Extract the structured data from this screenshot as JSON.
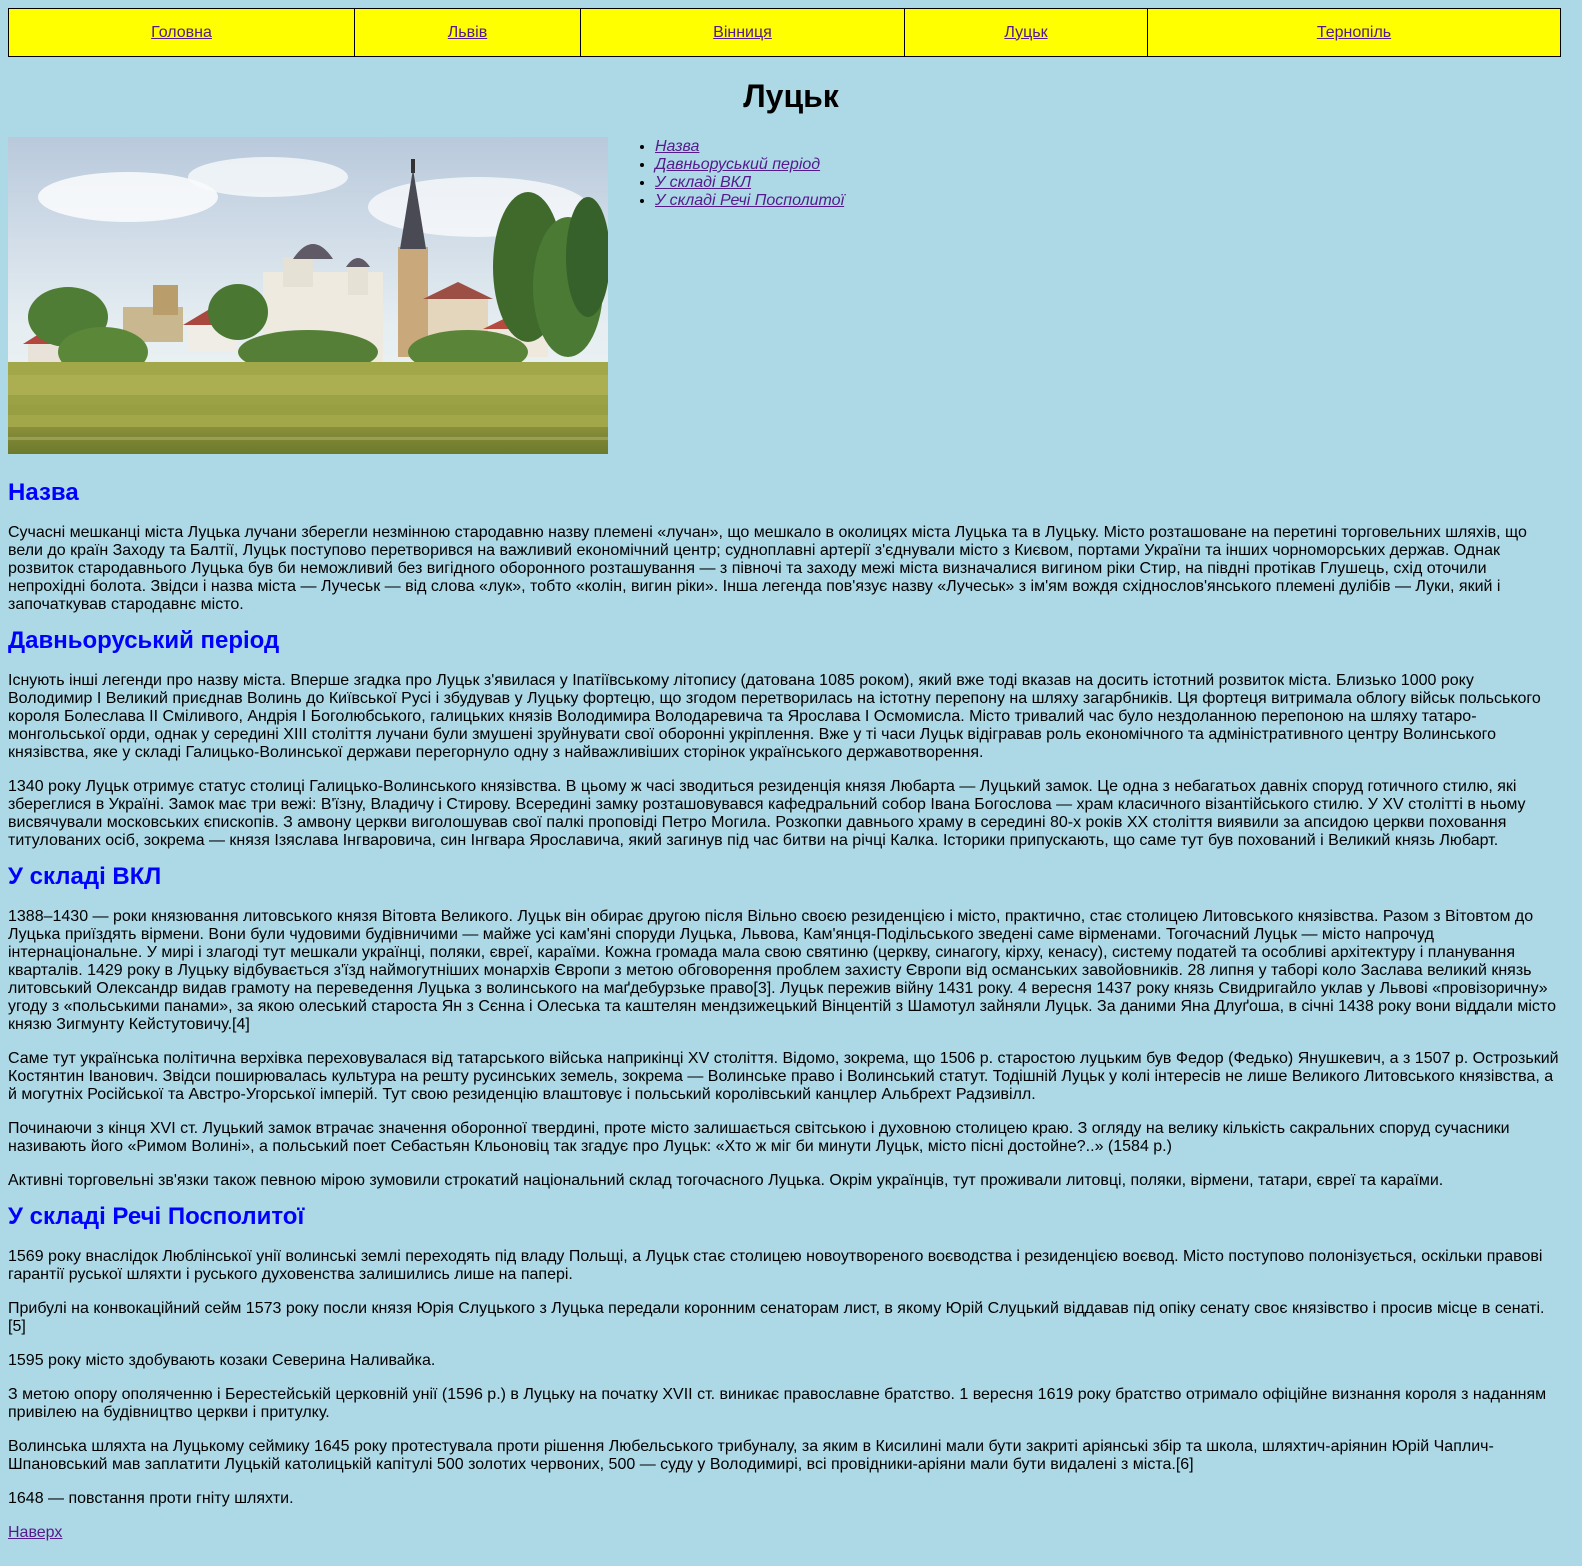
{
  "nav": [
    "Головна",
    "Львів",
    "Вінниця",
    "Луцьк",
    "Тернопіль"
  ],
  "page_title": "Луцьк",
  "toc": [
    "Назва",
    "Давньоруський період",
    "У складі ВКЛ",
    "У складі Речі Посполитої"
  ],
  "colors": {
    "background": "#add8e6",
    "nav_background": "#ffff00",
    "heading": "#0000ff",
    "link": "#551a8b"
  },
  "sections": [
    {
      "heading": "Назва",
      "paragraphs": [
        "Сучасні мешканці міста Луцька лучани зберегли незмінною стародавню назву племені «лучан», що мешкало в околицях міста Луцька та в Луцьку. Місто розташоване на перетині торговельних шляхів, що вели до країн Заходу та Балтії, Луцьк поступово перетворився на важливий економічний центр; судноплавні артерії з'єднували місто з Києвом, портами України та інших чорноморських держав. Однак розвиток стародавнього Луцька був би неможливий без вигідного оборонного розташування — з півночі та заходу межі міста визначалися вигином ріки Стир, на півдні протікав Глушець, схід оточили непрохідні болота. Звідси і назва міста — Лучеськ — від слова «лук», тобто «колін, вигин ріки». Інша легенда пов'язує назву «Лучеськ» з ім'ям вождя східнослов'янського племені дулібів — Луки, який і започаткував стародавнє місто."
      ]
    },
    {
      "heading": "Давньоруський період",
      "paragraphs": [
        "Існують інші легенди про назву міста. Вперше згадка про Луцьк з'явилася у Іпатіївському літопису (датована 1085 роком), який вже тоді вказав на досить істотний розвиток міста. Близько 1000 року Володимир I Великий приєднав Волинь до Київської Русі і збудував у Луцьку фортецю, що згодом перетворилась на істотну перепону на шляху загарбників. Ця фортеця витримала облогу військ польського короля Болеслава II Сміливого, Андрія I Боголюбського, галицьких князів Володимира Володаревича та Ярослава I Осмомисла. Місто тривалий час було нездоланною перепоною на шляху татаро-монгольської орди, однак у середині XIII століття лучани були змушені зруйнувати свої оборонні укріплення. Вже у ті часи Луцьк відігравав роль економічного та адміністративного центру Волинського князівства, яке у складі Галицько-Волинської держави перегорнуло одну з найважливіших сторінок українського державотворення.",
        "1340 року Луцьк отримує статус столиці Галицько-Волинського князівства. В цьому ж часі зводиться резиденція князя Любарта — Луцький замок. Це одна з небагатьох давніх споруд готичного стилю, які збереглися в Україні. Замок має три вежі: В'їзну, Владичу і Стирову. Всередині замку розташовувався кафедральний собор Івана Богослова — храм класичного візантійського стилю. У XV столітті в ньому висвячували московських єпископів. З амвону церкви виголошував свої палкі проповіді Петро Могила. Розкопки давнього храму в середині 80-х років XX століття виявили за апсидою церкви поховання титулованих осіб, зокрема — князя Ізяслава Інгваровича, син Інгвара Ярославича, який загинув під час битви на річці Калка. Історики припускають, що саме тут був похований і Великий князь Любарт."
      ]
    },
    {
      "heading": "У складі ВКЛ",
      "paragraphs": [
        "1388–1430 — роки князювання литовського князя Вітовта Великого. Луцьк він обирає другою після Вільно своєю резиденцією і місто, практично, стає столицею Литовського князівства. Разом з Вітовтом до Луцька приїздять вірмени. Вони були чудовими будівничими — майже усі кам'яні споруди Луцька, Львова, Кам'янця-Подільського зведені саме вірменами. Тогочасний Луцьк — місто напрочуд інтернаціональне. У мирі і злагоді тут мешкали українці, поляки, євреї, караїми. Кожна громада мала свою святиню (церкву, синагогу, кірху, кенасу), систему податей та особливі архітектуру і планування кварталів. 1429 року в Луцьку відбувається з'їзд наймогутніших монархів Європи з метою обговорення проблем захисту Європи від османських завойовників. 28 липня у таборі коло Заслава великий князь литовський Олександр видав грамоту на переведення Луцька з волинського на маґдебурзьке право[3]. Луцьк пережив війну 1431 року. 4 вересня 1437 року князь Свидригайло уклав у Львові «провізоричну» угоду з «польськими панами», за якою олеський староста Ян з Сєнна і Олеська та каштелян мендзижецький Вінцентій з Шамотул зайняли Луцьк. За даними Яна Длуґоша, в січні 1438 року вони віддали місто князю Зигмунту Кейстутовичу.[4]",
        "Саме тут українська політична верхівка переховувалася від татарського війська наприкінці XV століття. Відомо, зокрема, що 1506 р. старостою луцьким був Федор (Федько) Янушкевич, а з 1507 р. Острозький Костянтин Іванович. Звідси поширювалась культура на решту русинських земель, зокрема — Волинське право і Волинський статут. Тодішній Луцьк у колі інтересів не лише Великого Литовського князівства, а й могутніх Російської та Австро-Угорської імперій. Тут свою резиденцію влаштовує і польський королівський канцлер Альбрехт Радзивілл.",
        "Починаючи з кінця XVI ст. Луцький замок втрачає значення оборонної твердині, проте місто залишається світською і духовною столицею краю. З огляду на велику кількість сакральних споруд сучасники називають його «Римом Волині», а польський поет Себастьян Кльоновіц так згадує про Луцьк: «Хто ж міг би минути Луцьк, місто пісні достойне?..» (1584 р.)",
        "Активні торговельні зв'язки також певною мірою зумовили строкатий національний склад тогочасного Луцька. Окрім українців, тут проживали литовці, поляки, вірмени, татари, євреї та караїми."
      ]
    },
    {
      "heading": "У складі Речі Посполитої",
      "paragraphs": [
        "1569 року внаслідок Люблінської унії волинські землі переходять під владу Польщі, а Луцьк стає столицею новоутвореного воєводства і резиденцією воєвод. Місто поступово полонізується, оскільки правові гарантії руської шляхти і руського духовенства залишились лише на папері.",
        "Прибулі на конвокаційний сейм 1573 року посли князя Юрія Слуцького з Луцька передали коронним сенаторам лист, в якому Юрій Слуцький віддавав під опіку сенату своє князівство і просив місце в сенаті.[5]",
        "1595 року місто здобувають козаки Северина Наливайка.",
        "З метою опору ополяченню і Берестейській церковній унії (1596 р.) в Луцьку на початку XVII ст. виникає православне братство. 1 вересня 1619 року братство отримало офіційне визнання короля з наданням привілею на будівництво церкви і притулку.",
        "Волинська шляхта на Луцькому сеймику 1645 року протестувала проти рішення Любельського трибуналу, за яким в Кисилині мали бути закриті аріянські збір та школа, шляхтич-аріянин Юрій Чаплич-Шпановський мав заплатити Луцькій католицькій капітулі 500 золотих червоних, 500 — суду у Володимирі, всі провідники-аріяни мали бути видалені з міста.[6]",
        "1648 — повстання проти гніту шляхти."
      ]
    }
  ],
  "back_to_top": "Наверх"
}
